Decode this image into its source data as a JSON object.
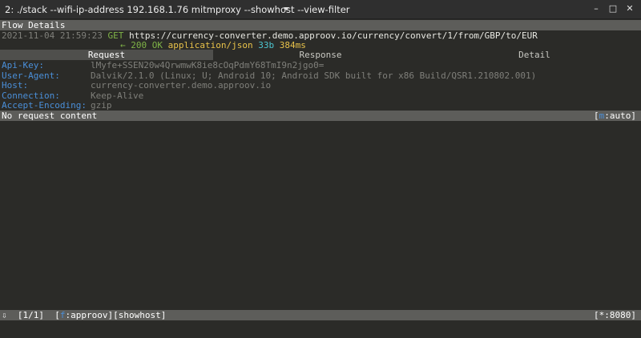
{
  "window": {
    "title": "2: ./stack --wifi-ip-address 192.168.1.76 mitmproxy --showhost --view-filter",
    "minimize_glyph": "–",
    "maximize_glyph": "□",
    "close_glyph": "✕"
  },
  "flow": {
    "header": "Flow Details",
    "timestamp": "2021-11-04 21:59:23",
    "method": "GET",
    "url": "https://currency-converter.demo.approov.io/currency/convert/1/from/GBP/to/EUR",
    "arrow": "←",
    "status": "200 OK",
    "content_type": "application/json",
    "size": "33b",
    "duration": "384ms"
  },
  "tabs": [
    "Request",
    "Response",
    "Detail"
  ],
  "headers": [
    {
      "name": "Api-Key:",
      "value": "lMyfe+SSEN20w4QrwmwK8ie8cOqPdmY68TmI9n2jgo0="
    },
    {
      "name": "User-Agent:",
      "value": "Dalvik/2.1.0 (Linux; U; Android 10; Android SDK built for x86 Build/QSR1.210802.001)"
    },
    {
      "name": "Host:",
      "value": "currency-converter.demo.approov.io"
    },
    {
      "name": "Connection:",
      "value": "Keep-Alive"
    },
    {
      "name": "Accept-Encoding:",
      "value": "gzip"
    }
  ],
  "content_bar": {
    "text": "No request content",
    "mode_key": "m",
    "mode_value": ":auto",
    "open_bracket": "[",
    "close_bracket": "]"
  },
  "footer": {
    "arrow": "⇩",
    "position": "[1/1]",
    "filter_key": "f",
    "filter_value": ":approov]",
    "filter_open": "[",
    "showhost": "[showhost]",
    "listen": "[*:8080]"
  },
  "colors": {
    "background": "#2b2b28",
    "header_key": "#4a8fd9",
    "method": "#7fb347",
    "content_type": "#e8c24a",
    "size": "#4cc4cf"
  }
}
